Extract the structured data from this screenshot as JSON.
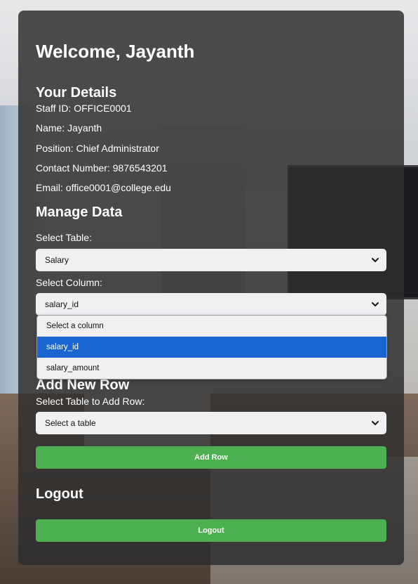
{
  "welcome": "Welcome, Jayanth",
  "details": {
    "heading": "Your Details",
    "staff_id": "Staff ID: OFFICE0001",
    "name": "Name: Jayanth",
    "position": "Position: Chief Administrator",
    "contact": "Contact Number: 9876543201",
    "email": "Email: office0001@college.edu"
  },
  "manage": {
    "heading": "Manage Data",
    "table_label": "Select Table:",
    "table_value": "Salary",
    "column_label": "Select Column:",
    "column_value": "salary_id",
    "column_options": [
      "Select a column",
      "salary_id",
      "salary_amount"
    ],
    "selected_option_index": 1
  },
  "add_row": {
    "heading": "Add New Row",
    "label": "Select Table to Add Row:",
    "select_value": "Select a table",
    "button": "Add Row"
  },
  "logout": {
    "heading": "Logout",
    "button": "Logout"
  },
  "colors": {
    "panel": "#2d2d2d",
    "button": "#4caf50",
    "selected_option": "#1a66d1"
  },
  "icons": {
    "select_chevron": "chevron-down-icon"
  }
}
